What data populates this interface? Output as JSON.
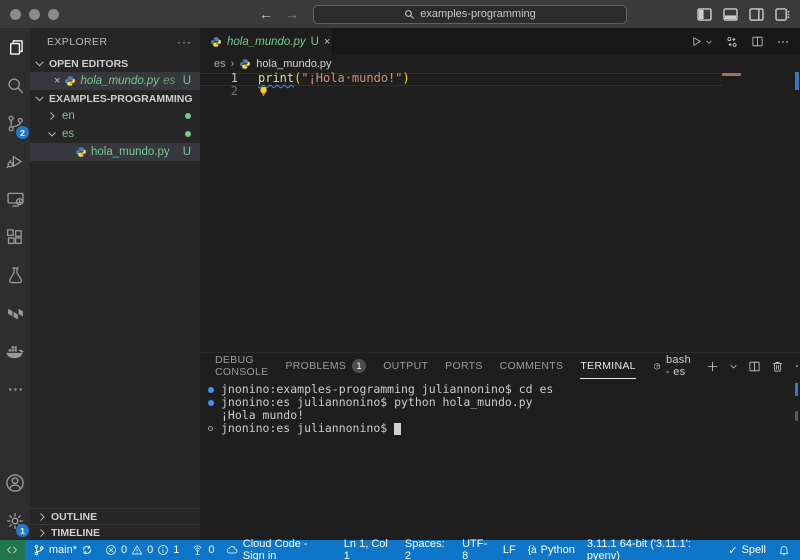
{
  "titlebar": {
    "search_text": "examples-programming",
    "back": "←",
    "forward": "→"
  },
  "activity_bar": {
    "source_control_badge": "2",
    "settings_badge": "1"
  },
  "sidebar": {
    "title": "EXPLORER",
    "more": "···",
    "open_editors": {
      "label": "OPEN EDITORS",
      "close": "×",
      "file": "hola_mundo.py",
      "detail": "es",
      "status": "U"
    },
    "workspace": {
      "label": "EXAMPLES-PROGRAMMING",
      "folder_en": "en",
      "folder_es": "es",
      "file": "hola_mundo.py",
      "file_status": "U"
    },
    "outline_label": "OUTLINE",
    "timeline_label": "TIMELINE"
  },
  "editor": {
    "tab": {
      "file": "hola_mundo.py",
      "status": "U",
      "close": "×"
    },
    "breadcrumb": {
      "folder": "es",
      "sep": "›",
      "file": "hola_mundo.py"
    },
    "line_numbers": [
      "1",
      "2"
    ],
    "code": {
      "fn": "print",
      "open": "(",
      "str": "\"¡Hola·mundo!\"",
      "close": ")"
    }
  },
  "panel": {
    "tabs": [
      {
        "label": "DEBUG CONSOLE"
      },
      {
        "label": "PROBLEMS",
        "badge": "1"
      },
      {
        "label": "OUTPUT"
      },
      {
        "label": "PORTS"
      },
      {
        "label": "COMMENTS"
      },
      {
        "label": "TERMINAL"
      }
    ],
    "shell_label": "bash - es",
    "terminal_lines": [
      {
        "text": "jnonino:examples-programming juliannonino$ cd es"
      },
      {
        "text": "jnonino:es juliannonino$ python hola_mundo.py"
      },
      {
        "text": "¡Hola mundo!"
      },
      {
        "text": "jnonino:es juliannonino$"
      }
    ]
  },
  "status_bar": {
    "branch": "main*",
    "errors": "0",
    "warnings": "0",
    "infos": "1",
    "ports": "0",
    "cloud": "Cloud Code - Sign in",
    "cursor": "Ln 1, Col 1",
    "spaces": "Spaces: 2",
    "encoding": "UTF-8",
    "eol": "LF",
    "lang_icon": "{à",
    "language": "Python",
    "interpreter": "3.11.1 64-bit ('3.11.1': pyenv)",
    "spell_check": "✓",
    "spell": "Spell"
  },
  "colors": {
    "statusbar_blue": "#0e76c9",
    "remote_green": "#20764a",
    "git_green": "#73c991",
    "string_orange": "#ce9178",
    "function_gold": "#dcdcaa",
    "badge_blue": "#2678cb",
    "terminal_dot_blue": "#3794ff"
  }
}
